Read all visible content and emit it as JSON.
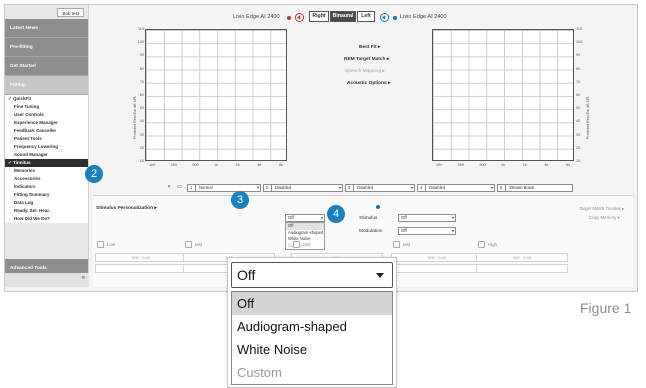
{
  "sidebar": {
    "top_button": "Bob test",
    "sections_top": [
      "Latest News",
      "Pre-fitting",
      "Get Started"
    ],
    "fitting_section": "Fitting",
    "fitting_items": [
      {
        "label": "QuickFit",
        "checked": true,
        "current": false
      },
      {
        "label": "Fine Tuning",
        "checked": false,
        "current": false
      },
      {
        "label": "User Controls",
        "checked": false,
        "current": false
      },
      {
        "label": "Experience Manager",
        "checked": false,
        "current": false
      },
      {
        "label": "Feedback Canceller",
        "checked": false,
        "current": false
      },
      {
        "label": "Patient Tools",
        "checked": false,
        "current": false
      },
      {
        "label": "Frequency Lowering",
        "checked": false,
        "current": false
      },
      {
        "label": "Sound Manager",
        "checked": false,
        "current": false
      },
      {
        "label": "Tinnitus",
        "checked": true,
        "current": true
      },
      {
        "label": "Memories",
        "checked": false,
        "current": false
      },
      {
        "label": "Accessories",
        "checked": false,
        "current": false
      },
      {
        "label": "Indicators",
        "checked": false,
        "current": false
      },
      {
        "label": "Fitting Summary",
        "checked": false,
        "current": false
      },
      {
        "label": "Data Log",
        "checked": false,
        "current": false
      },
      {
        "label": "Ready. Set. Hear.",
        "checked": false,
        "current": false
      },
      {
        "label": "How Did We Do?",
        "checked": false,
        "current": false
      }
    ],
    "advanced_section": "Advanced Tools",
    "collapse_glyph": "«"
  },
  "header": {
    "left_device": "Livio Edge AI 2400",
    "right_device": "Livio Edge AI 2400",
    "ear_tabs": [
      "Right",
      "Binaural",
      "Left"
    ],
    "selected_tab": "Binaural",
    "right_color": "#c0392b",
    "left_color": "#1b6fb8"
  },
  "chart_data": [
    {
      "type": "line",
      "title": "",
      "ylabel": "Predicted Real Ear dB SPL",
      "yticks": [
        "110",
        "100",
        "90",
        "80",
        "70",
        "60",
        "50",
        "40",
        "30",
        "20",
        "10"
      ],
      "xticks": [
        "100",
        "250",
        "500",
        "1k",
        "2k",
        "4k",
        "8k"
      ],
      "series": []
    },
    {
      "type": "line",
      "title": "",
      "ylabel": "Predicted Real Ear dB SPL",
      "yticks": [
        "110",
        "100",
        "90",
        "80",
        "70",
        "60",
        "50",
        "40",
        "30",
        "20",
        "10"
      ],
      "xticks": [
        "100",
        "250",
        "500",
        "1k",
        "2k",
        "4k",
        "8k"
      ],
      "series": []
    }
  ],
  "center_menu": [
    "Best Fit",
    "REM Target Match",
    "Speech Mapping",
    "Acoustic Options"
  ],
  "channels": [
    {
      "num": "1",
      "label": "Normal"
    },
    {
      "num": "2",
      "label": "Disabled"
    },
    {
      "num": "3",
      "label": "Disabled"
    },
    {
      "num": "4",
      "label": "Disabled"
    },
    {
      "num": "5",
      "label": "Stream Boost"
    }
  ],
  "tinnitus": {
    "personalization": "Stimulus Personalization",
    "stimulus_label": "Stimulus",
    "stimulus_value": "Off",
    "modulation_label": "Modulation",
    "modulation_value": "Off",
    "target_match": "Target Match Tinnitus",
    "copy_memory": "Copy Memory",
    "small_dropdown_value": "Off",
    "small_options": [
      "Off",
      "Audiogram-shaped",
      "White Noise",
      "Custom"
    ],
    "band_labels": [
      "Low",
      "Mid",
      "Mid",
      "Mid",
      "High"
    ],
    "row_values": [
      "500 - 0.00",
      "1.00",
      "0.00",
      "500 - 0.00",
      "500 - 0.00"
    ]
  },
  "zoom_dropdown": {
    "value": "Off",
    "options": [
      "Off",
      "Audiogram-shaped",
      "White Noise",
      "Custom"
    ]
  },
  "callouts": [
    "2",
    "3",
    "4"
  ],
  "caption": "Figure 1"
}
